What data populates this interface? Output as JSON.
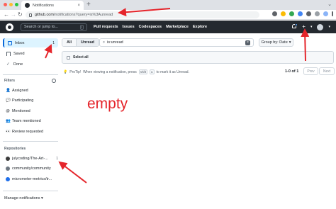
{
  "browser": {
    "tab_title": "Notifications",
    "tab_close": "×",
    "new_tab": "+",
    "url_host": "github.com",
    "url_path": "/notifications?query=is%3Aunread",
    "menu_glyph": "⌄"
  },
  "header": {
    "search_placeholder": "Search or jump to...",
    "search_key": "/",
    "nav": [
      "Pull requests",
      "Issues",
      "Codespaces",
      "Marketplace",
      "Explore"
    ],
    "plus_label": "+",
    "caret": "▾"
  },
  "sidebar": {
    "inbox": {
      "label": "Inbox",
      "count": "1"
    },
    "saved": "Saved",
    "done": "Done",
    "filters_title": "Filters",
    "filters": [
      {
        "emoji": "👤",
        "label": "Assigned"
      },
      {
        "emoji": "💬",
        "label": "Participating"
      },
      {
        "emoji": "@",
        "label": "Mentioned"
      },
      {
        "emoji": "👥",
        "label": "Team mentioned"
      },
      {
        "emoji": "👀",
        "label": "Review requested"
      }
    ],
    "repos_title": "Repositories",
    "repos": [
      {
        "name": "julycoding/The-Art-...",
        "count": "1",
        "color": "#3b3b3b"
      },
      {
        "name": "community/community",
        "count": "",
        "color": "#6e7781"
      },
      {
        "name": "micrometer-metrics/tr...",
        "count": "",
        "color": "#1f6feb"
      }
    ],
    "manage": "Manage notifications ▾"
  },
  "main": {
    "tab_all": "All",
    "tab_unread": "Unread",
    "filter_value": "is:unread",
    "filter_clear": "×",
    "groupby": "Group by: Date",
    "groupby_caret": "▾",
    "select_all": "Select all",
    "protip_lead": "ProTip!",
    "protip_text_a": "When viewing a notification, press",
    "protip_key1": "shift",
    "protip_key2": "u",
    "protip_text_b": "to mark it as Unread.",
    "pager_count": "1-0 of 1",
    "prev": "Prev",
    "next": "Next"
  },
  "annotation": {
    "text": "empty",
    "color": "#e5252b"
  }
}
